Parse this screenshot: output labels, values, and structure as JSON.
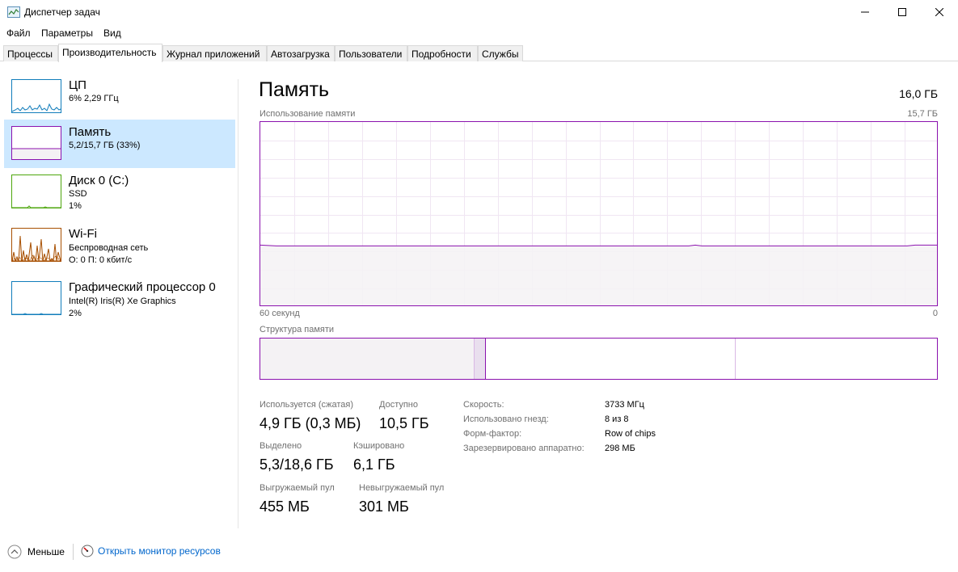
{
  "window": {
    "title": "Диспетчер задач",
    "icon": "task-manager-icon",
    "controls": [
      "minimize-icon",
      "maximize-icon",
      "close-icon"
    ]
  },
  "menu": [
    "Файл",
    "Параметры",
    "Вид"
  ],
  "tabs": [
    {
      "label": "Процессы",
      "active": false
    },
    {
      "label": "Производительность",
      "active": true
    },
    {
      "label": "Журнал приложений",
      "active": false
    },
    {
      "label": "Автозагрузка",
      "active": false
    },
    {
      "label": "Пользователи",
      "active": false
    },
    {
      "label": "Подробности",
      "active": false
    },
    {
      "label": "Службы",
      "active": false
    }
  ],
  "sidebar": {
    "items": [
      {
        "name": "ЦП",
        "line1": "6% 2,29 ГГц",
        "line2": "",
        "line3": "",
        "color": "#117dbb",
        "active": false
      },
      {
        "name": "Память",
        "line1": "5,2/15,7 ГБ (33%)",
        "line2": "",
        "line3": "",
        "color": "#8b12ae",
        "active": true
      },
      {
        "name": "Диск 0 (C:)",
        "line1": "SSD",
        "line2": "1%",
        "line3": "",
        "color": "#4da60c",
        "active": false
      },
      {
        "name": "Wi-Fi",
        "line1": "Беспроводная сеть",
        "line2": "О: 0 П: 0 кбит/с",
        "line3": "",
        "color": "#a74f01",
        "active": false
      },
      {
        "name": "Графический процессор 0",
        "line1": "Intel(R) Iris(R) Xe Graphics",
        "line2": "2%",
        "line3": "",
        "color": "#117dbb",
        "active": false
      }
    ]
  },
  "main": {
    "title": "Память",
    "total": "16,0 ГБ",
    "usage_label": "Использование памяти",
    "usage_max": "15,7 ГБ",
    "time_left": "60 секунд",
    "time_right": "0",
    "structure_label": "Структура памяти",
    "accent": "#8b12ae",
    "usage_fraction": 0.33
  },
  "stats": {
    "in_use_label": "Используется (сжатая)",
    "in_use_value": "4,9 ГБ (0,3 МБ)",
    "available_label": "Доступно",
    "available_value": "10,5 ГБ",
    "committed_label": "Выделено",
    "committed_value": "5,3/18,6 ГБ",
    "cached_label": "Кэшировано",
    "cached_value": "6,1 ГБ",
    "paged_label": "Выгружаемый пул",
    "paged_value": "455 МБ",
    "nonpaged_label": "Невыгружаемый пул",
    "nonpaged_value": "301 МБ"
  },
  "specs": [
    {
      "label": "Скорость:",
      "value": "3733 МГц"
    },
    {
      "label": "Использовано гнезд:",
      "value": "8 из 8"
    },
    {
      "label": "Форм-фактор:",
      "value": "Row of chips"
    },
    {
      "label": "Зарезервировано аппаратно:",
      "value": "298 МБ"
    }
  ],
  "footer": {
    "less_label": "Меньше",
    "link_label": "Открыть монитор ресурсов"
  }
}
